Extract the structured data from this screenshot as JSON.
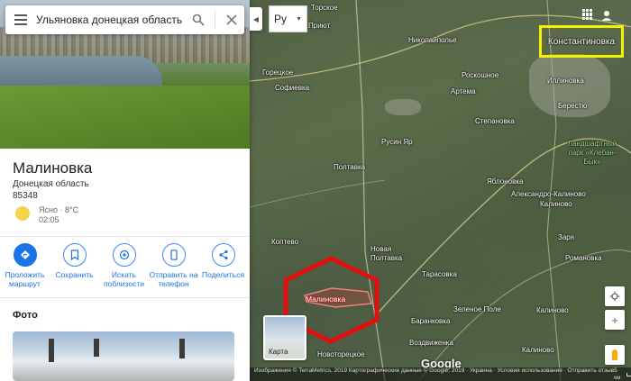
{
  "search": {
    "value": "Ульяновка донецкая область"
  },
  "place": {
    "title": "Малиновка",
    "region": "Донецкая область",
    "postal_code": "85348",
    "weather": {
      "condition": "Ясно · 8°C",
      "time": "02:05"
    }
  },
  "actions": [
    {
      "label": "Проложить маршрут",
      "icon": "directions-icon"
    },
    {
      "label": "Сохранить",
      "icon": "bookmark-icon"
    },
    {
      "label": "Искать поблизости",
      "icon": "nearby-icon"
    },
    {
      "label": "Отправить на телефон",
      "icon": "phone-icon"
    },
    {
      "label": "Поделиться",
      "icon": "share-icon"
    }
  ],
  "photos": {
    "heading": "Фото"
  },
  "map": {
    "language": "Ру",
    "highlight_label": "Константиновка",
    "marker_label": "Малиновка",
    "layer_toggle_label": "Карта",
    "google": "Google",
    "attribution": "Изображения © TerraMetrics, 2019 Картографические данные © Google, 2019 · Украина · Условия использования · Отправить отзыв",
    "scale": "5 км",
    "labels": [
      {
        "text": "Торское"
      },
      {
        "text": "Приют"
      },
      {
        "text": "Николайполье"
      },
      {
        "text": "Горецкое"
      },
      {
        "text": "Софиевка"
      },
      {
        "text": "Роскошное"
      },
      {
        "text": "Артема"
      },
      {
        "text": "Иллиновка"
      },
      {
        "text": "Берестю"
      },
      {
        "text": "Степановка"
      },
      {
        "text": "Русин Яр"
      },
      {
        "text": "Ландшафтный парк «Клебан-Бык»"
      },
      {
        "text": "Полтавка"
      },
      {
        "text": "Яблоновка"
      },
      {
        "text": "Александро-Калиново"
      },
      {
        "text": "Калиново"
      },
      {
        "text": "Коптево"
      },
      {
        "text": "Новая Полтавка"
      },
      {
        "text": "Заря"
      },
      {
        "text": "Тарасовка"
      },
      {
        "text": "Романовка"
      },
      {
        "text": "Зеленое Поле"
      },
      {
        "text": "Баранковка"
      },
      {
        "text": "Калиново"
      },
      {
        "text": "Воздвиженка"
      },
      {
        "text": "Новоторецкое"
      },
      {
        "text": "Калиново"
      }
    ]
  }
}
